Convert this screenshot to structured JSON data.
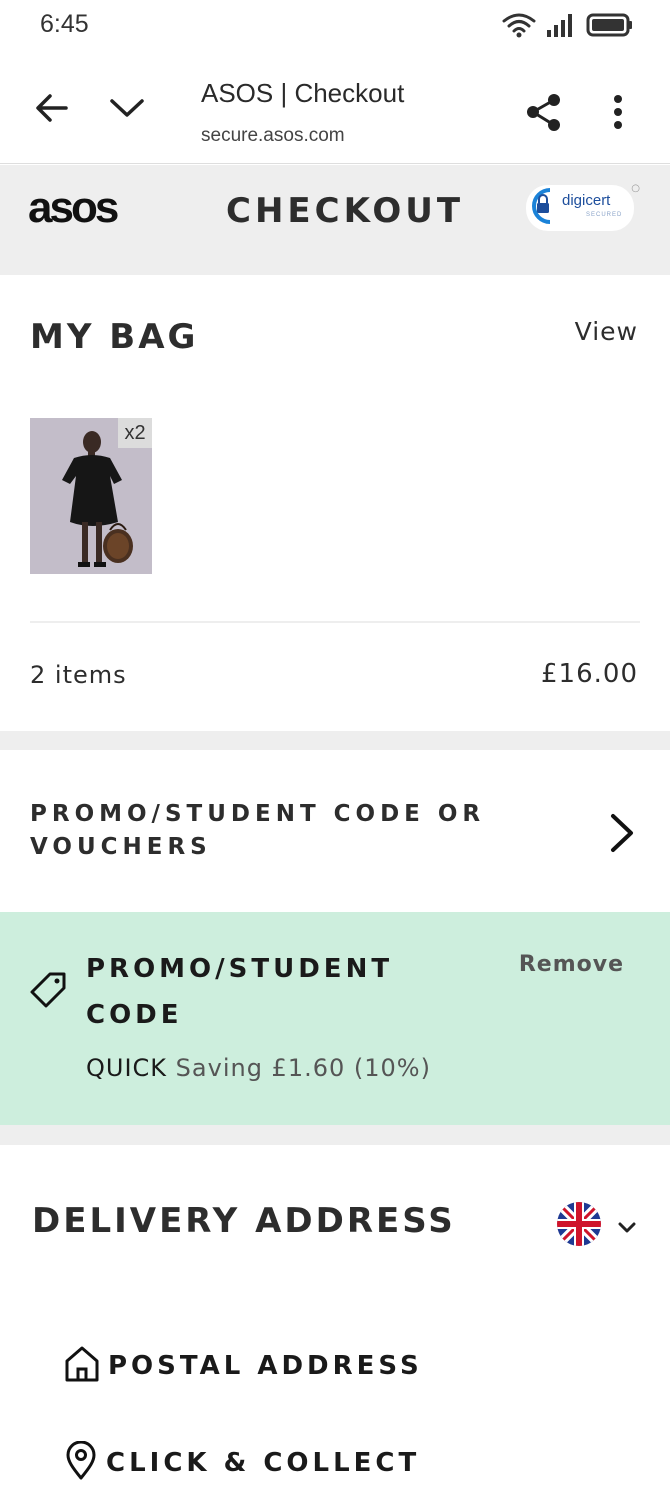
{
  "status_bar": {
    "time": "6:45"
  },
  "browser": {
    "title": "ASOS | Checkout",
    "url": "secure.asos.com"
  },
  "header": {
    "logo": "asos",
    "title": "CHECKOUT",
    "badge_text": "digicert",
    "badge_sub": "SECURED"
  },
  "bag": {
    "title": "MY BAG",
    "view_label": "View",
    "item_quantity": "x2",
    "item_count": "2 items",
    "total": "£16.00"
  },
  "promo": {
    "row_label": "PROMO/STUDENT CODE OR VOUCHERS",
    "applied_title": "PROMO/STUDENT CODE",
    "remove_label": "Remove",
    "code": "QUICK",
    "saving": "Saving £1.60 (10%)"
  },
  "delivery": {
    "title": "DELIVERY ADDRESS",
    "country_icon": "uk-flag-icon",
    "options": [
      {
        "label": "POSTAL ADDRESS",
        "icon": "home-icon"
      },
      {
        "label": "CLICK & COLLECT",
        "icon": "location-pin-icon"
      }
    ]
  },
  "colors": {
    "header_bg": "#eeeeee",
    "promo_applied_bg": "#cdeedd",
    "text": "#2d2d2d",
    "digicert_blue": "#1d4e9c"
  }
}
